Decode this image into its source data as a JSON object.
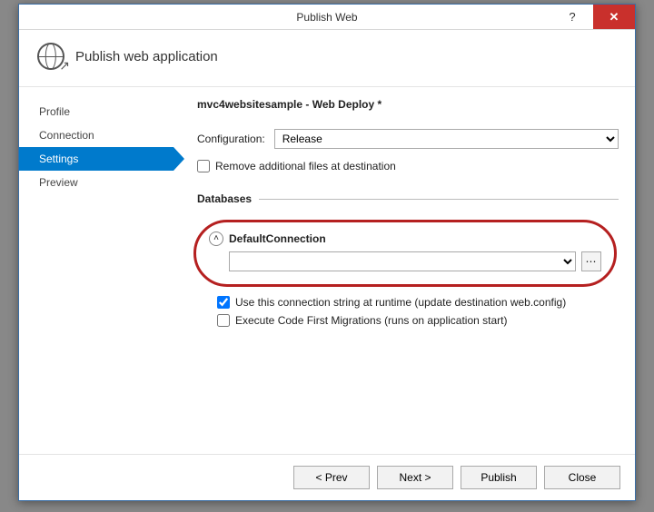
{
  "window": {
    "title": "Publish Web"
  },
  "header": {
    "title": "Publish web application"
  },
  "sidebar": {
    "items": [
      {
        "label": "Profile"
      },
      {
        "label": "Connection"
      },
      {
        "label": "Settings"
      },
      {
        "label": "Preview"
      }
    ],
    "active_index": 2
  },
  "main": {
    "heading": "mvc4websitesample - Web Deploy *",
    "configuration": {
      "label": "Configuration:",
      "value": "Release"
    },
    "remove_files": {
      "label": "Remove additional files at destination",
      "checked": false
    },
    "databases": {
      "section_label": "Databases",
      "connection": {
        "name": "DefaultConnection",
        "expanded": true,
        "connection_string": "",
        "use_at_runtime": {
          "label": "Use this connection string at runtime (update destination web.config)",
          "checked": true
        },
        "code_first_migrations": {
          "label": "Execute Code First Migrations (runs on application start)",
          "checked": false
        }
      }
    }
  },
  "footer": {
    "prev": "< Prev",
    "next": "Next >",
    "publish": "Publish",
    "close": "Close"
  }
}
